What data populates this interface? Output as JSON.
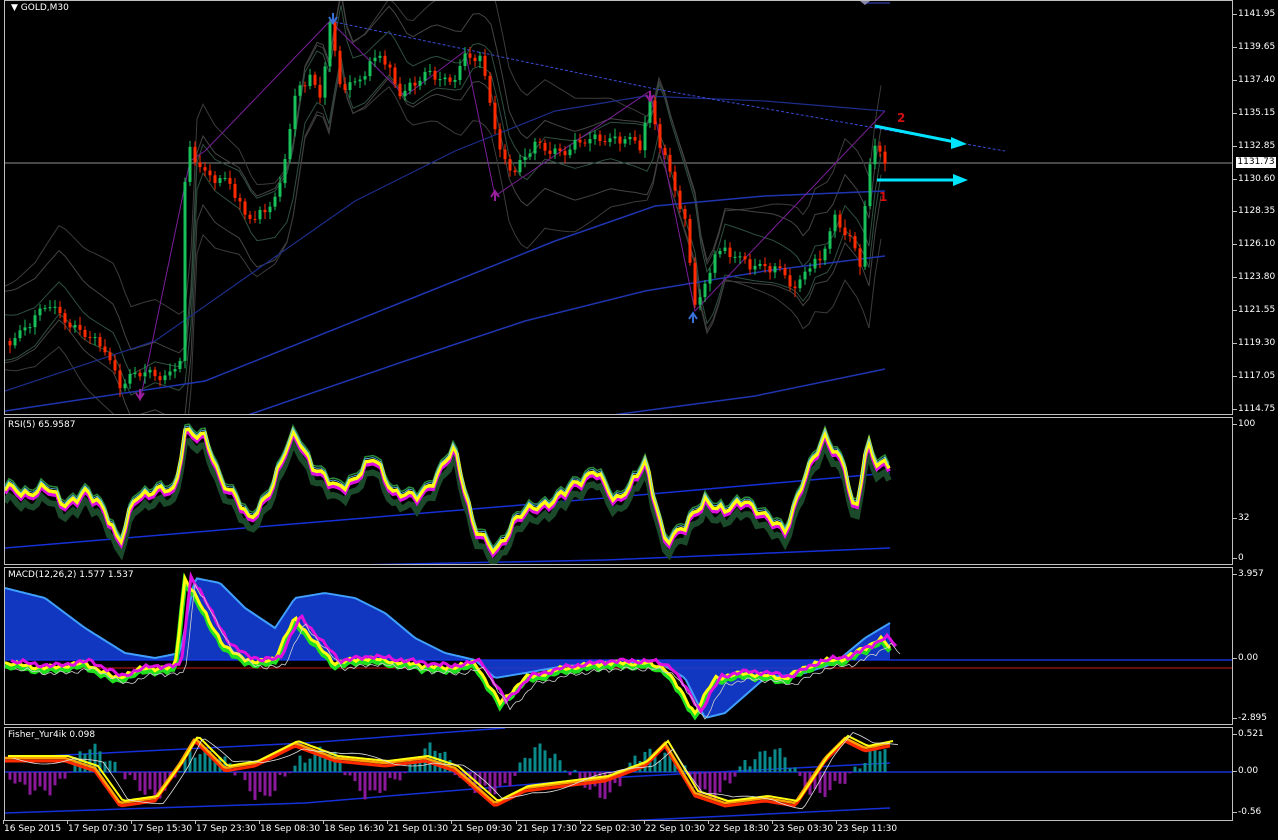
{
  "chart": {
    "symbol_label": "GOLD,M30",
    "current_price": "1131.73",
    "price_scale": [
      "1141.95",
      "1139.65",
      "1137.40",
      "1135.15",
      "1132.85",
      "1130.60",
      "1128.35",
      "1126.10",
      "1123.80",
      "1121.55",
      "1119.30",
      "1117.05",
      "1114.75"
    ],
    "annotations": {
      "label_1": "1",
      "label_2": "2"
    },
    "colors": {
      "bull_candle": "#19c15a",
      "bear_candle": "#ff2a00",
      "arrow_cyan": "#00e5ff",
      "trend_line": "#3a4bd6",
      "annotation_red": "#d01010"
    },
    "icons": [
      "dropdown-triangle-icon",
      "down-arrow-marker-icon",
      "up-arrow-marker-icon"
    ]
  },
  "rsi": {
    "label": "RSI(5) 65.9587",
    "scale": [
      "100",
      "32",
      "0"
    ]
  },
  "macd": {
    "label": "MACD(12,26,2) 1.577 1.537",
    "scale": [
      "3.957",
      "0.00",
      "-2.895"
    ]
  },
  "fisher": {
    "label": "Fisher_Yur4ik 0.098",
    "scale": [
      "0.521",
      "0.00",
      "-0.56"
    ]
  },
  "time_axis": [
    "16 Sep 2015",
    "17 Sep 07:30",
    "17 Sep 15:30",
    "17 Sep 23:30",
    "18 Sep 08:30",
    "18 Sep 16:30",
    "21 Sep 01:30",
    "21 Sep 09:30",
    "21 Sep 17:30",
    "22 Sep 02:30",
    "22 Sep 10:30",
    "22 Sep 18:30",
    "23 Sep 03:30",
    "23 Sep 11:30"
  ]
}
